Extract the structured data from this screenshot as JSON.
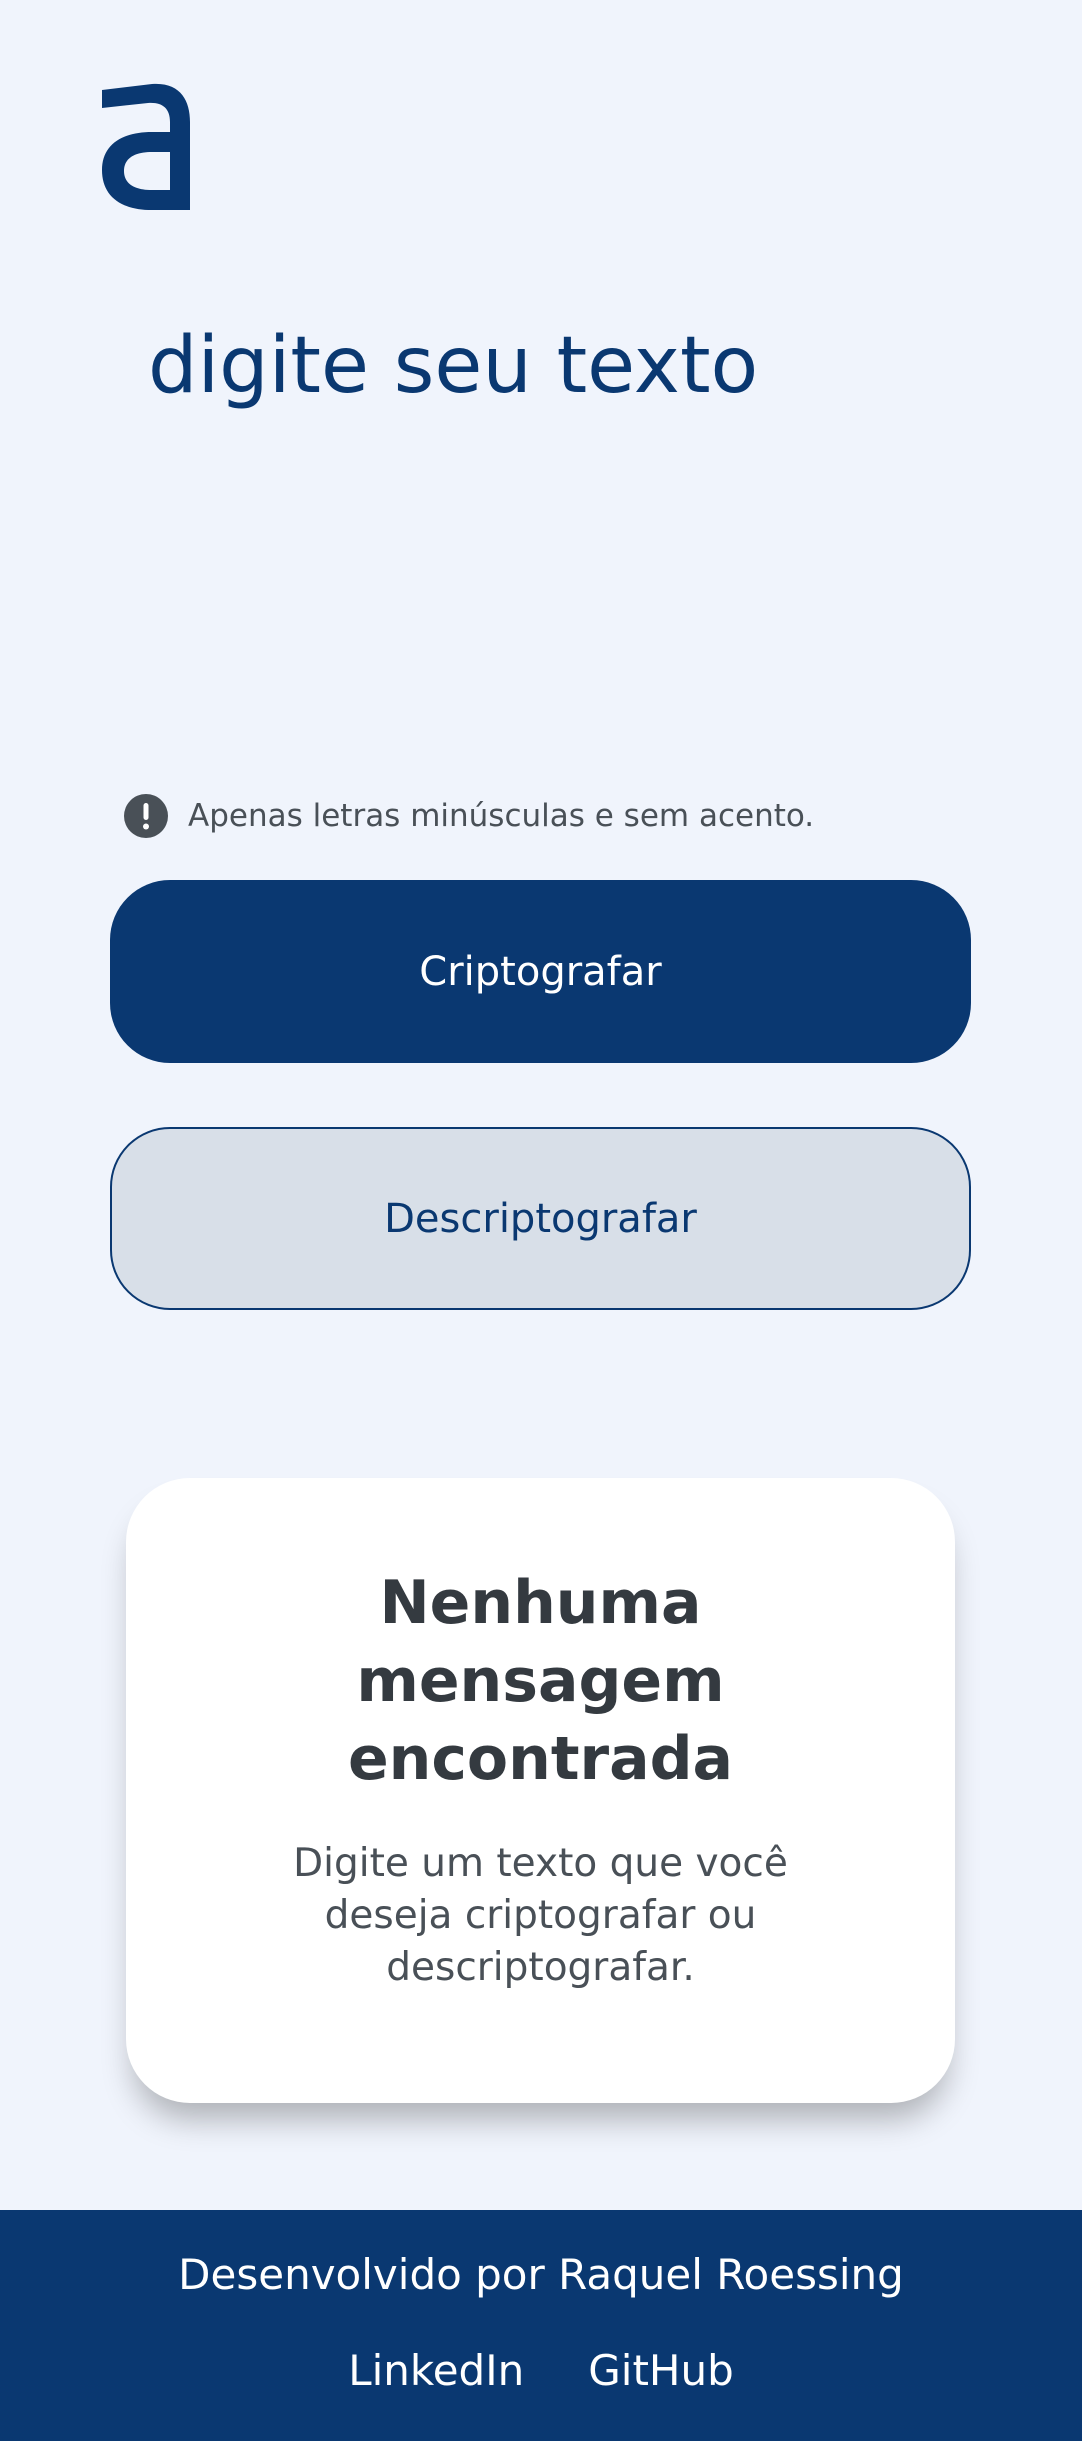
{
  "logo": {
    "icon": "alura-a-logo-icon",
    "color": "#0A3871"
  },
  "input": {
    "placeholder": "digite seu texto",
    "value": ""
  },
  "hint": {
    "icon": "exclamation-circle-icon",
    "text": "Apenas letras minúsculas e sem acento."
  },
  "actions": {
    "encrypt_label": "Criptografar",
    "decrypt_label": "Descriptografar"
  },
  "output": {
    "title": "Nenhuma mensagem encontrada",
    "description": "Digite um texto que você deseja criptografar ou descriptografar."
  },
  "footer": {
    "credit": "Desenvolvido por Raquel Roessing",
    "links": [
      "LinkedIn",
      "GitHub"
    ]
  },
  "colors": {
    "primary": "#0A3871",
    "background": "#F0F4FC",
    "secondary_button": "#D8DFE8",
    "text_dark": "#343A40",
    "text_muted": "#495057"
  }
}
